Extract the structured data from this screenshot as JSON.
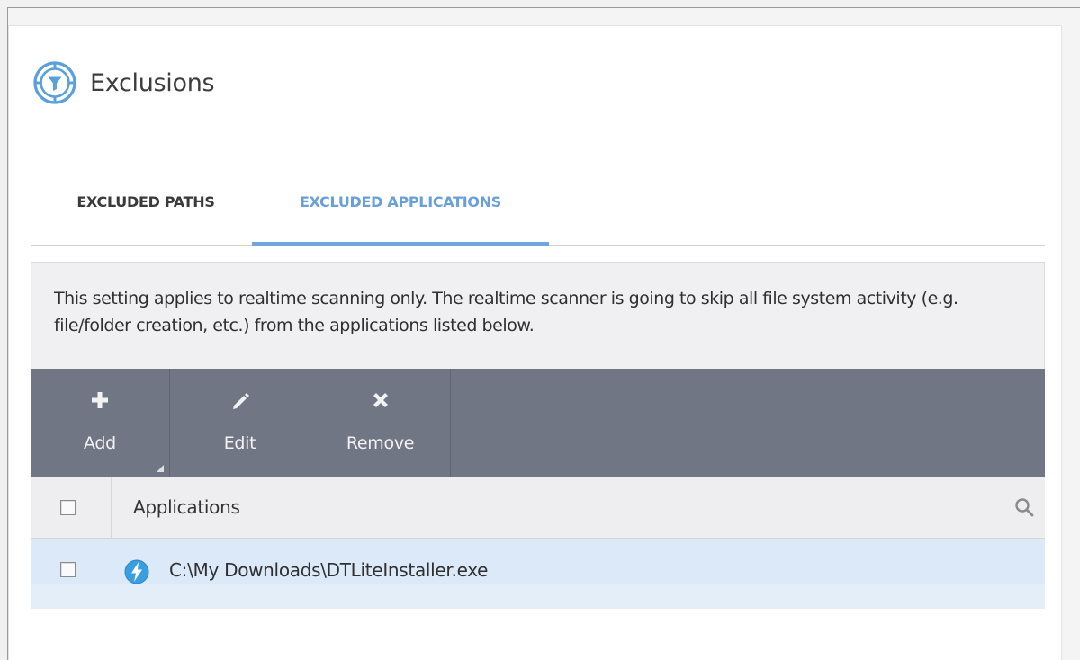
{
  "header": {
    "title": "Exclusions",
    "icon": "exclusions-filter-icon"
  },
  "tabs": [
    {
      "label": "EXCLUDED PATHS",
      "active": false
    },
    {
      "label": "EXCLUDED APPLICATIONS",
      "active": true
    }
  ],
  "description": "This setting applies to realtime scanning only. The realtime scanner is going to skip all file system activity (e.g. file/folder creation, etc.) from the applications listed below.",
  "toolbar": {
    "add_label": "Add",
    "edit_label": "Edit",
    "remove_label": "Remove"
  },
  "table": {
    "column_header": "Applications",
    "rows": [
      {
        "path": "C:\\My Downloads\\DTLiteInstaller.exe",
        "icon": "daemon-tools-lightning-icon",
        "checked": false
      }
    ]
  },
  "colors": {
    "accent": "#6aa0d8",
    "toolbar": "#707684",
    "row_selected": "#dbe9f8"
  }
}
